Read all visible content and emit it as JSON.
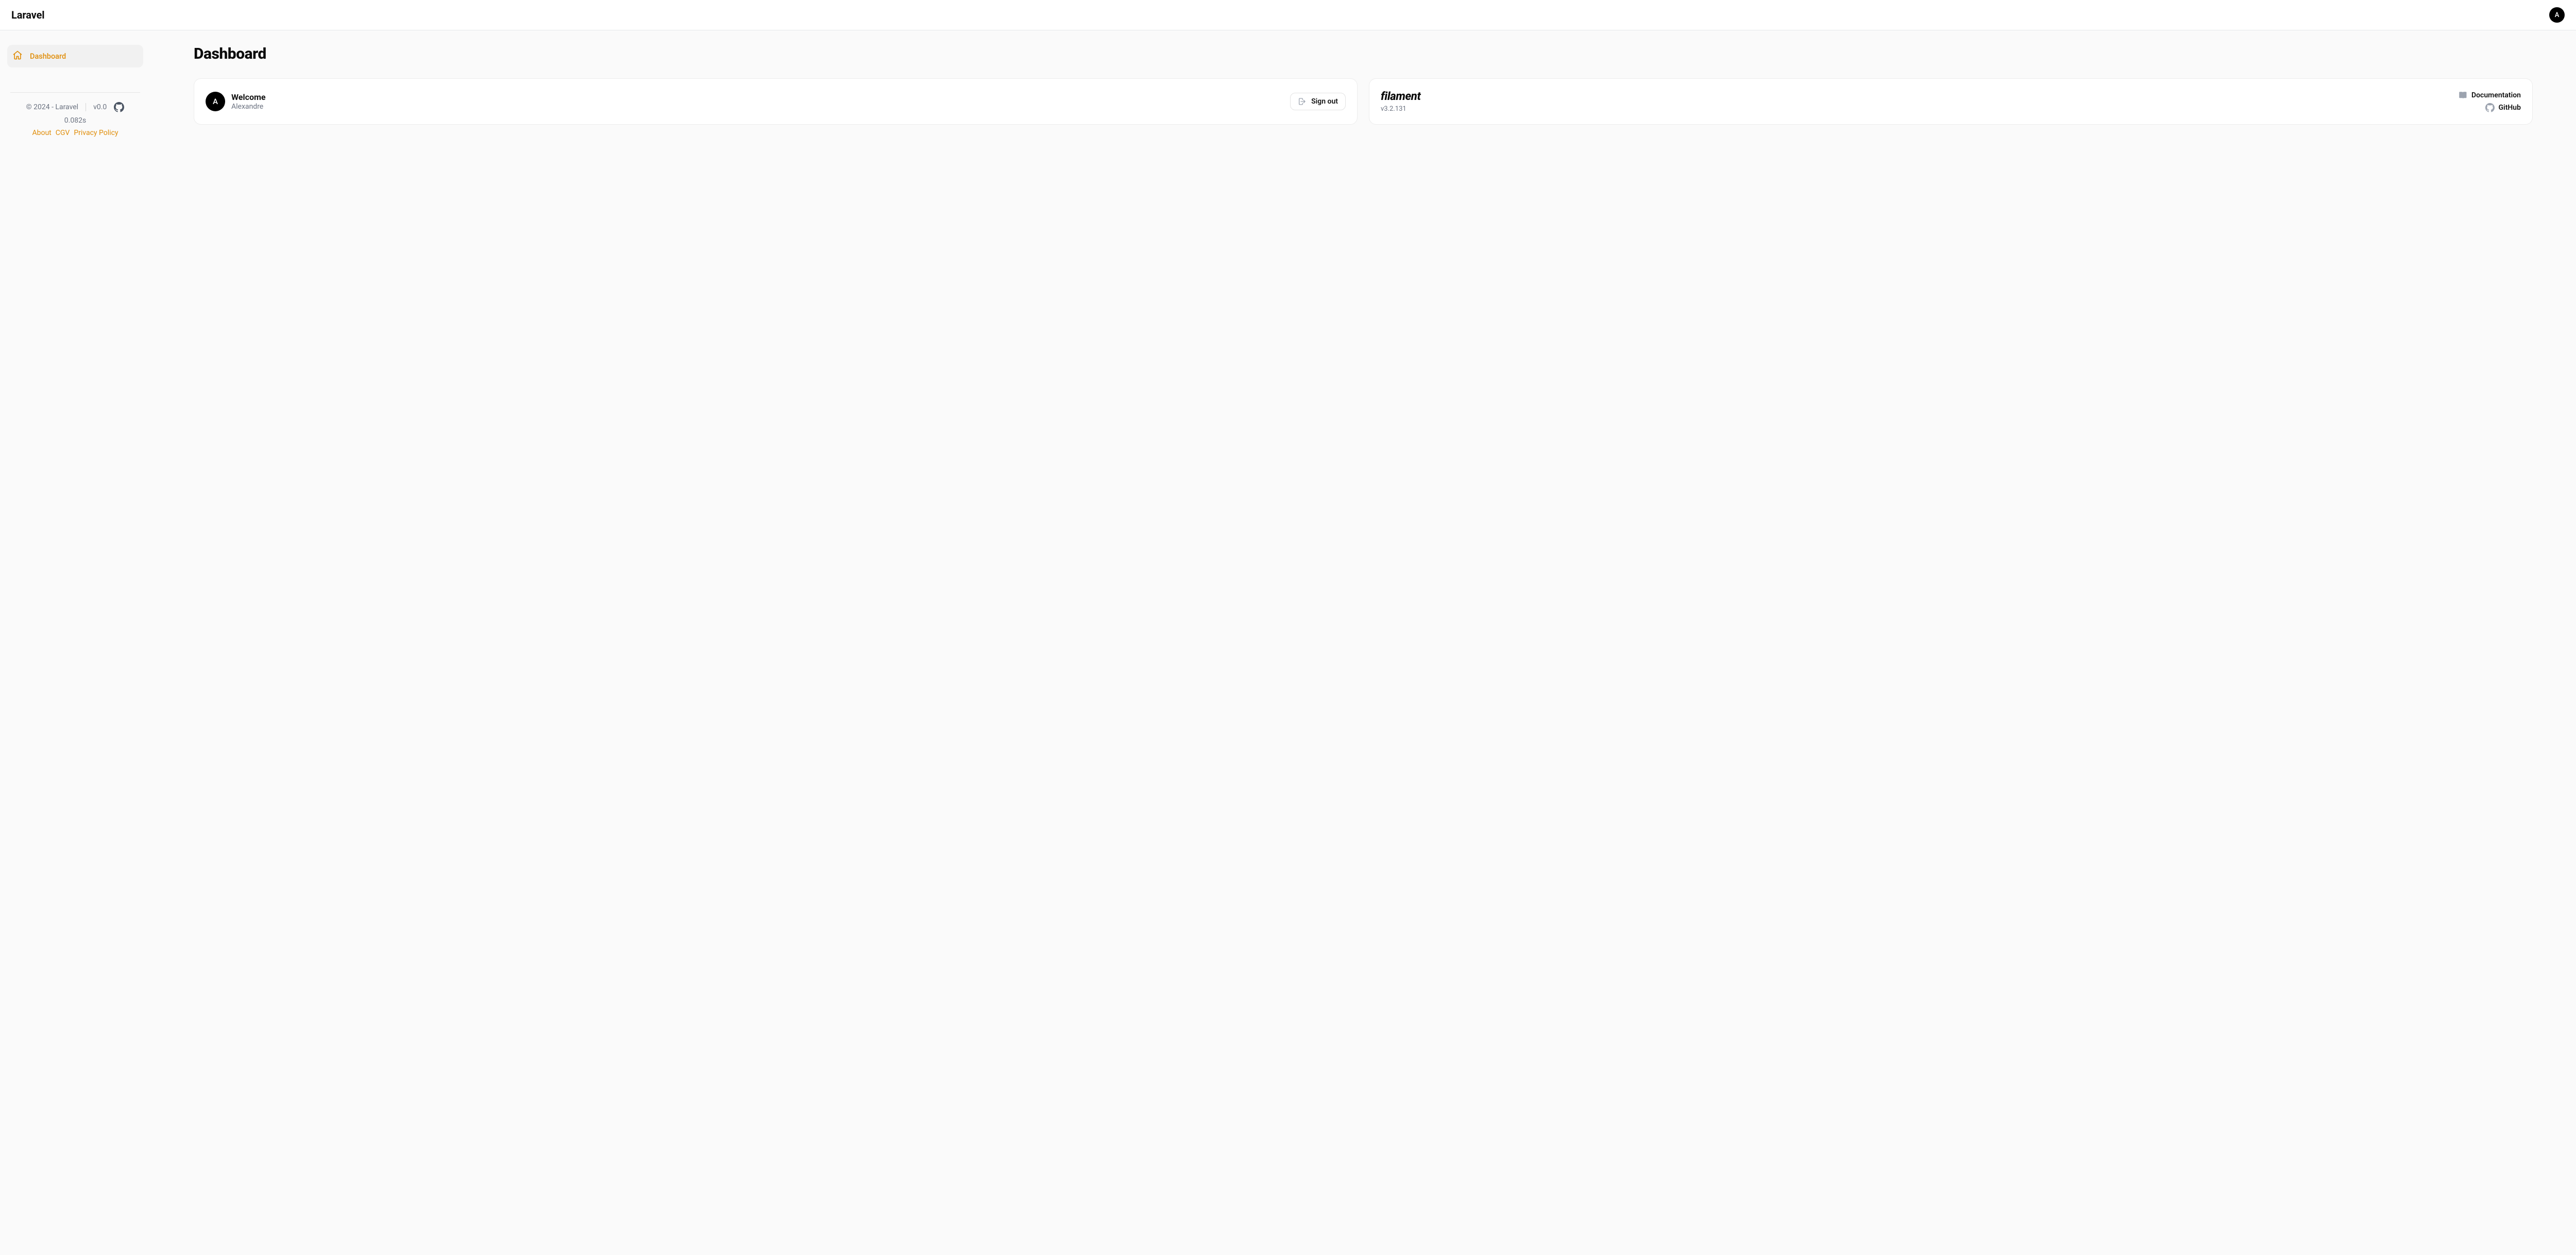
{
  "header": {
    "brand": "Laravel",
    "avatar_initial": "A"
  },
  "sidebar": {
    "items": [
      {
        "label": "Dashboard"
      }
    ],
    "footer": {
      "copyright": "© 2024 - Laravel",
      "version": "v0.0",
      "timing": "0.082s",
      "links": {
        "about": "About",
        "cgv": "CGV",
        "privacy": "Privacy Policy"
      }
    }
  },
  "main": {
    "title": "Dashboard",
    "welcome_card": {
      "avatar_initial": "A",
      "title": "Welcome",
      "subtitle": "Alexandre",
      "signout_label": "Sign out"
    },
    "filament_card": {
      "logo_text": "filament",
      "version": "v3.2.131",
      "documentation_label": "Documentation",
      "github_label": "GitHub"
    }
  }
}
